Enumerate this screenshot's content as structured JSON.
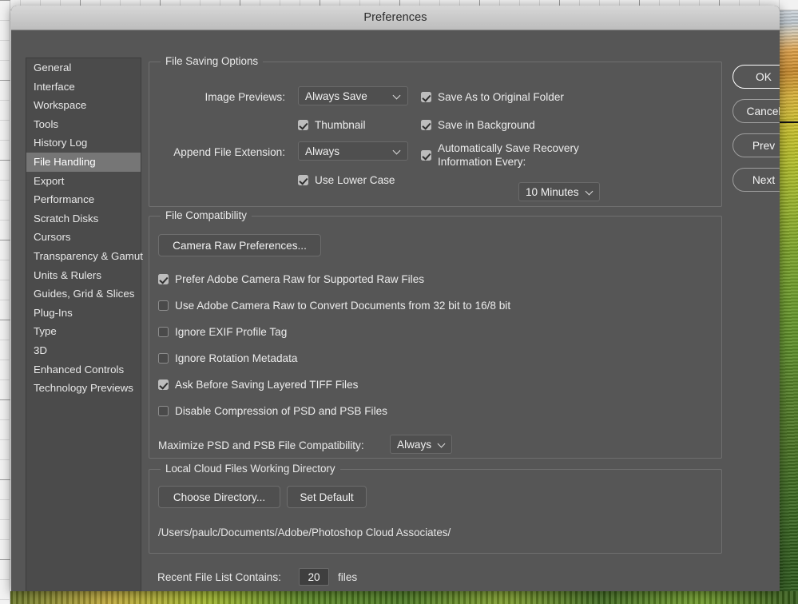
{
  "window": {
    "title": "Preferences"
  },
  "sidebar": {
    "items": [
      {
        "label": "General",
        "selected": false
      },
      {
        "label": "Interface",
        "selected": false
      },
      {
        "label": "Workspace",
        "selected": false
      },
      {
        "label": "Tools",
        "selected": false
      },
      {
        "label": "History Log",
        "selected": false
      },
      {
        "label": "File Handling",
        "selected": true
      },
      {
        "label": "Export",
        "selected": false
      },
      {
        "label": "Performance",
        "selected": false
      },
      {
        "label": "Scratch Disks",
        "selected": false
      },
      {
        "label": "Cursors",
        "selected": false
      },
      {
        "label": "Transparency & Gamut",
        "selected": false
      },
      {
        "label": "Units & Rulers",
        "selected": false
      },
      {
        "label": "Guides, Grid & Slices",
        "selected": false
      },
      {
        "label": "Plug-Ins",
        "selected": false
      },
      {
        "label": "Type",
        "selected": false
      },
      {
        "label": "3D",
        "selected": false
      },
      {
        "label": "Enhanced Controls",
        "selected": false
      },
      {
        "label": "Technology Previews",
        "selected": false
      }
    ]
  },
  "file_saving_options": {
    "legend": "File Saving Options",
    "image_previews_label": "Image Previews:",
    "image_previews_value": "Always Save",
    "thumbnail_label": "Thumbnail",
    "thumbnail_checked": true,
    "append_file_extension_label": "Append File Extension:",
    "append_file_extension_value": "Always",
    "use_lower_case_label": "Use Lower Case",
    "use_lower_case_checked": true,
    "save_as_original_folder_label": "Save As to Original Folder",
    "save_as_original_folder_checked": true,
    "save_in_background_label": "Save in Background",
    "save_in_background_checked": true,
    "auto_save_recovery_label": "Automatically Save Recovery Information Every:",
    "auto_save_recovery_checked": true,
    "auto_save_interval_value": "10 Minutes"
  },
  "file_compatibility": {
    "legend": "File Compatibility",
    "camera_raw_preferences_button": "Camera Raw Preferences...",
    "checkboxes": [
      {
        "label": "Prefer Adobe Camera Raw for Supported Raw Files",
        "checked": true
      },
      {
        "label": "Use Adobe Camera Raw to Convert Documents from 32 bit to 16/8 bit",
        "checked": false
      },
      {
        "label": "Ignore EXIF Profile Tag",
        "checked": false
      },
      {
        "label": "Ignore Rotation Metadata",
        "checked": false
      },
      {
        "label": "Ask Before Saving Layered TIFF Files",
        "checked": true
      },
      {
        "label": "Disable Compression of PSD and PSB Files",
        "checked": false
      }
    ],
    "maximize_label": "Maximize PSD and PSB File Compatibility:",
    "maximize_value": "Always"
  },
  "local_cloud": {
    "legend": "Local Cloud Files Working Directory",
    "choose_directory_button": "Choose Directory...",
    "set_default_button": "Set Default",
    "path": "/Users/paulc/Documents/Adobe/Photoshop Cloud Associates/"
  },
  "recent_files": {
    "label": "Recent File List Contains:",
    "value": "20",
    "suffix": "files"
  },
  "actions": {
    "ok": "OK",
    "cancel": "Cancel",
    "prev": "Prev",
    "next": "Next"
  },
  "colors": {
    "dialog_bg": "#565656",
    "sidebar_bg": "#4b4b4b",
    "selected_item_bg": "#767676",
    "text": "#ececec",
    "titlebar_text": "#2b2b2b"
  }
}
